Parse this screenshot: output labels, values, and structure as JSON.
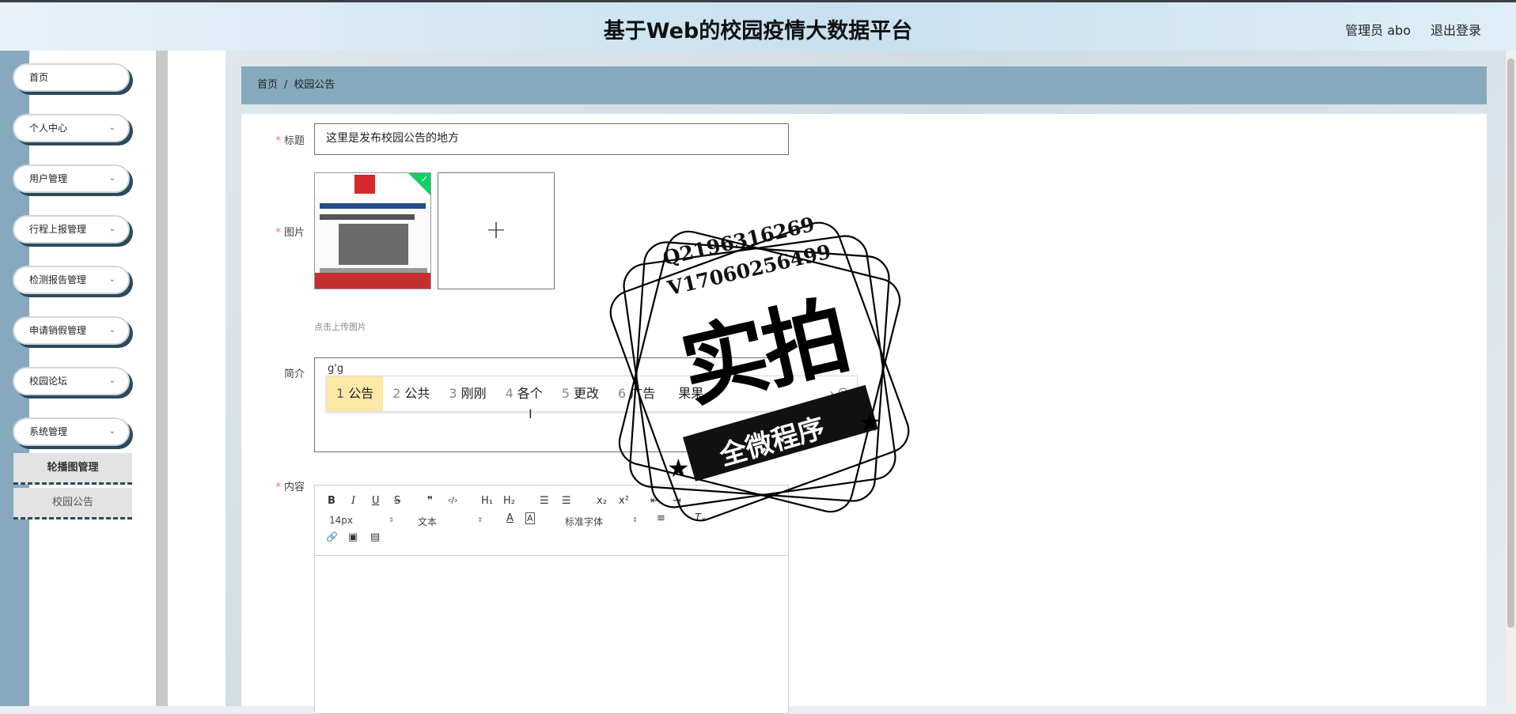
{
  "header": {
    "title": "基于Web的校园疫情大数据平台",
    "user": "管理员 abo",
    "logout": "退出登录"
  },
  "sidebar": {
    "items": [
      {
        "label": "首页"
      },
      {
        "label": "个人中心"
      },
      {
        "label": "用户管理"
      },
      {
        "label": "行程上报管理"
      },
      {
        "label": "检测报告管理"
      },
      {
        "label": "申请销假管理"
      },
      {
        "label": "校园论坛"
      },
      {
        "label": "系统管理"
      }
    ],
    "submenu": [
      {
        "label": "轮播图管理"
      },
      {
        "label": "校园公告"
      }
    ]
  },
  "breadcrumb": {
    "home": "首页",
    "sep": "/",
    "current": "校园公告"
  },
  "form": {
    "title_label": "标题",
    "title_value": "这里是发布校园公告的地方",
    "image_label": "图片",
    "upload_plus": "+",
    "upload_hint": "点击上传图片",
    "summary_label": "简介",
    "summary_typed": "g'g",
    "content_label": "内容",
    "required_mark": "*"
  },
  "ime": {
    "candidates": [
      {
        "n": "1",
        "text": "公告"
      },
      {
        "n": "2",
        "text": "公共"
      },
      {
        "n": "3",
        "text": "刚刚"
      },
      {
        "n": "4",
        "text": "各个"
      },
      {
        "n": "5",
        "text": "更改"
      },
      {
        "n": "6",
        "text": "广告"
      },
      {
        "n": "",
        "text": "果果"
      }
    ],
    "more": "›  ☺"
  },
  "editor": {
    "font_size": "14px",
    "text_type": "文本",
    "font_family": "标准字体",
    "buttons": {
      "bold": "B",
      "italic": "I",
      "underline": "U",
      "strike": "S",
      "quote": "❞",
      "code": "‹/›",
      "h1": "H₁",
      "h2": "H₂",
      "ol": "☰",
      "ul": "☰",
      "sub": "x₂",
      "sup": "x²",
      "outdent": "⇤",
      "indent": "⇥",
      "color": "A",
      "bg": "A",
      "align": "≡",
      "clean": "Tₓ",
      "link": "🔗",
      "image": "▣",
      "video": "▤"
    }
  },
  "watermark": {
    "line1": "Q2196316269",
    "line2": "V17060256499",
    "big": "实拍",
    "ribbon": "全微程序"
  }
}
